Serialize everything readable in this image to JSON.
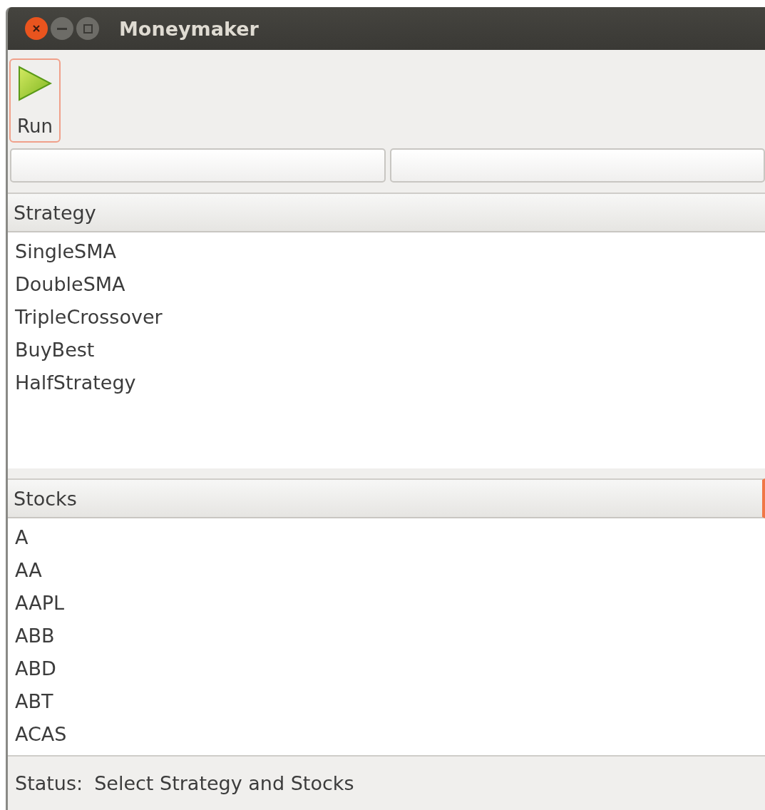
{
  "window": {
    "title": "Moneymaker"
  },
  "toolbar": {
    "run_button": {
      "label": "Run",
      "focused": true
    }
  },
  "fields": [
    {
      "kind": "entry"
    },
    {
      "kind": "entry"
    }
  ],
  "strategy": {
    "header": "Strategy",
    "items": [
      {
        "label": "SingleSMA"
      },
      {
        "label": "DoubleSMA"
      },
      {
        "label": "TripleCrossover"
      },
      {
        "label": "BuyBest"
      },
      {
        "label": "HalfStrategy"
      }
    ]
  },
  "stocks": {
    "header": "Stocks",
    "items": [
      {
        "label": "A"
      },
      {
        "label": "AA"
      },
      {
        "label": "AAPL"
      },
      {
        "label": "ABB"
      },
      {
        "label": "ABD"
      },
      {
        "label": "ABT"
      },
      {
        "label": "ACAS"
      }
    ]
  },
  "status_bar": {
    "label": "Status:",
    "text": "Select Strategy and Stocks"
  }
}
